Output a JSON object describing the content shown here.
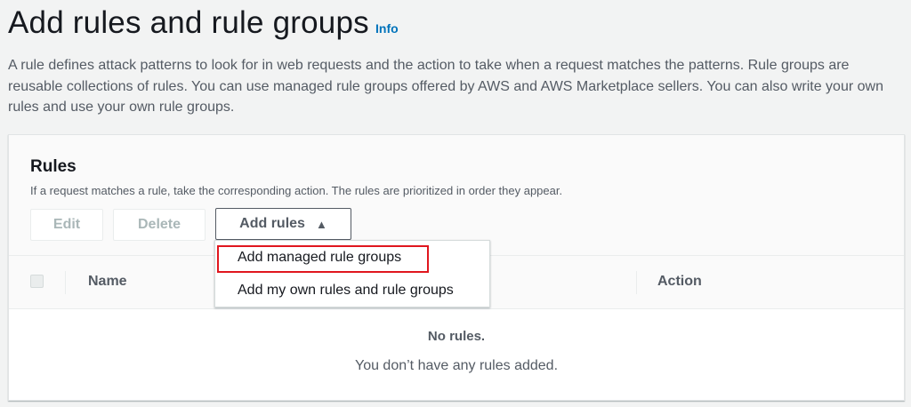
{
  "header": {
    "title": "Add rules and rule groups",
    "info_label": "Info",
    "description": "A rule defines attack patterns to look for in web requests and the action to take when a request matches the patterns. Rule groups are reusable collections of rules. You can use managed rule groups offered by AWS and AWS Marketplace sellers. You can also write your own rules and use your own rule groups."
  },
  "rules_panel": {
    "title": "Rules",
    "subtitle": "If a request matches a rule, take the corresponding action. The rules are prioritized in order they appear.",
    "buttons": {
      "edit": "Edit",
      "delete": "Delete",
      "add_rules": "Add rules",
      "add_rules_icon": "caret-up-icon"
    },
    "table": {
      "columns": [
        "Name",
        "Action"
      ],
      "empty_title": "No rules.",
      "empty_description": "You don’t have any rules added."
    },
    "dropdown": {
      "items": [
        "Add managed rule groups",
        "Add my own rules and rule groups"
      ],
      "highlighted_item": "Add managed rule groups"
    }
  },
  "colors": {
    "link": "#0073bb",
    "highlight": "#e0161e",
    "page_background": "#f2f3f3"
  }
}
